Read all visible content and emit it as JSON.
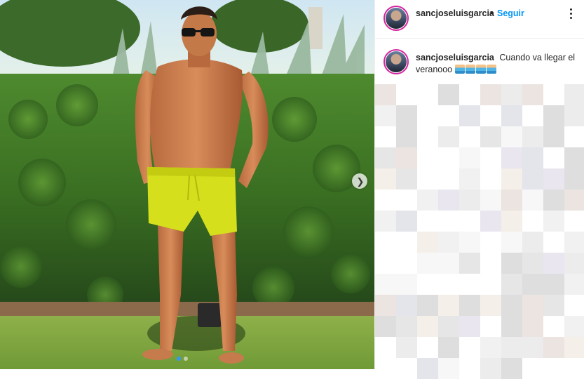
{
  "post": {
    "username": "sancjoseluisgarcia",
    "separator": "•",
    "follow_label": "Seguir",
    "caption": "Cuando va llegar el veranooo",
    "caption_emoji_count": 4,
    "caption_emoji": "swimmer-emoji"
  },
  "carousel": {
    "total_slides": 2,
    "current_slide": 1
  },
  "icons": {
    "more": "more-options-icon",
    "next": "chevron-right-icon"
  },
  "colors": {
    "follow": "#0095f6",
    "avatar_ring": "#d6249f",
    "active_dot": "#3897f0"
  }
}
